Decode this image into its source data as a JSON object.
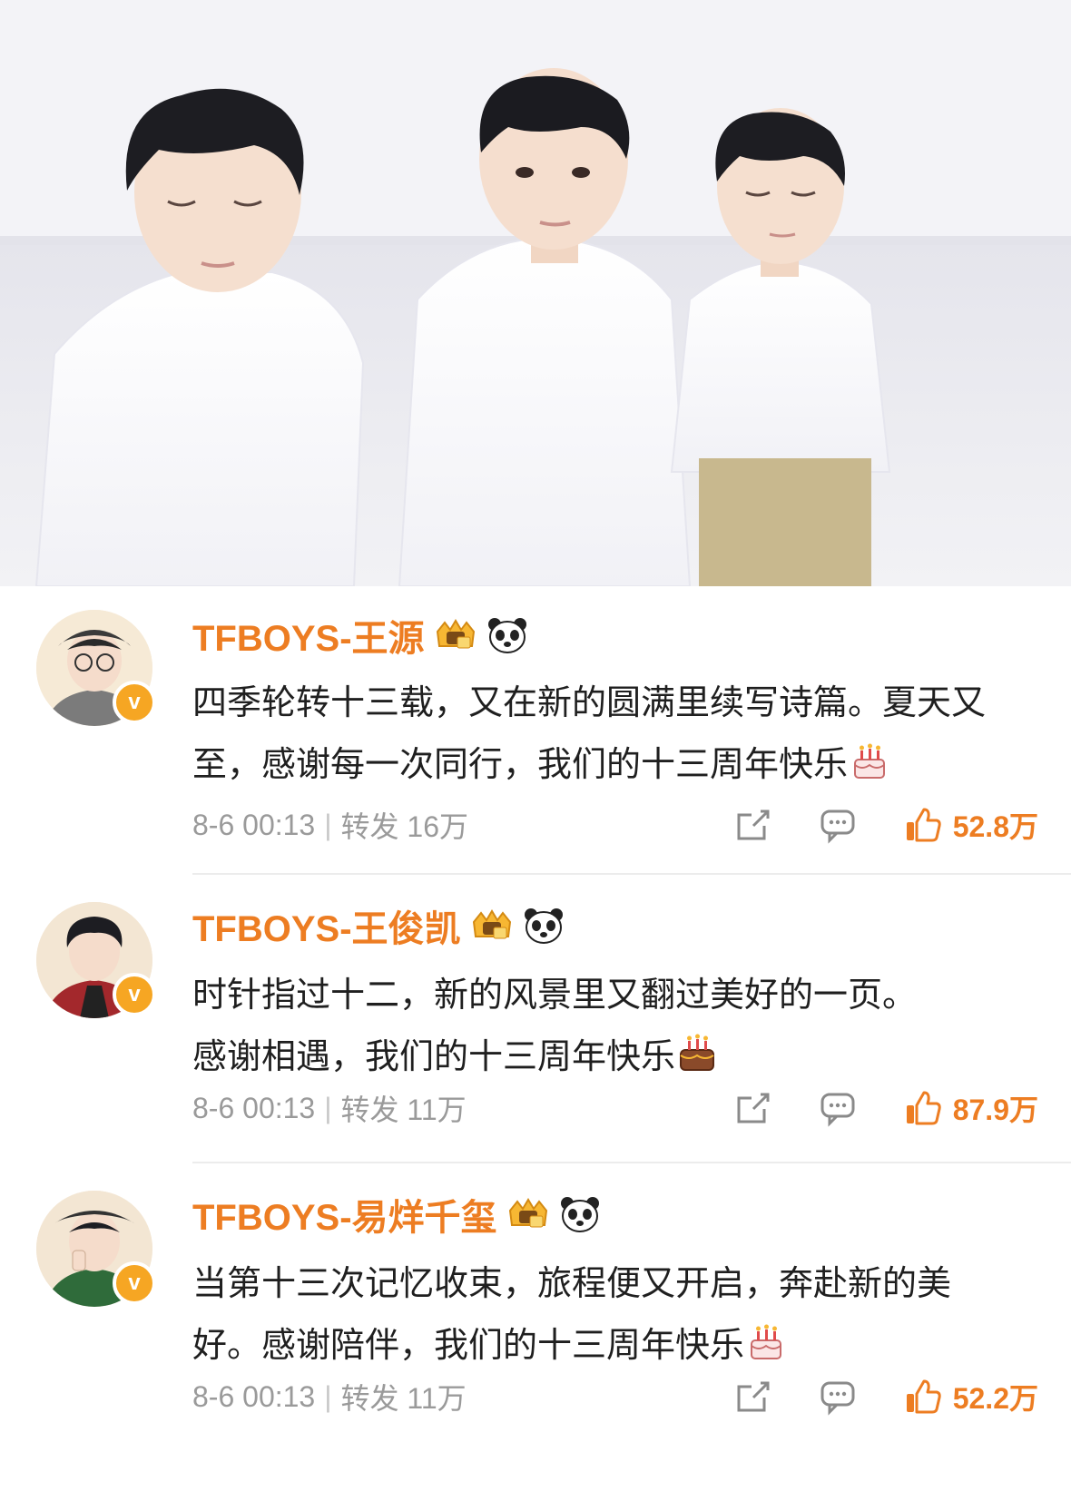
{
  "hero": {
    "image": "three-boys-white-shirts-photo"
  },
  "colors": {
    "name": "#ed7d22",
    "like": "#ed7d22",
    "meta": "#9a9a9a",
    "verified": "#f6a623"
  },
  "icons": {
    "verified": "v",
    "badge": "crown-badge-icon",
    "panda": "panda-icon",
    "cake": "birthday-cake-icon",
    "share": "share-icon",
    "comment": "comment-icon",
    "like": "thumbs-up-icon"
  },
  "posts": [
    {
      "name": "TFBOYS-王源",
      "text": "四季轮转十三载，又在新的圆满里续写诗篇。夏天又至，感谢每一次同行，我们的十三周年快乐",
      "time": "8-6 00:13",
      "sep": "|",
      "repost": "转发 16万",
      "likes": "52.8万"
    },
    {
      "name": "TFBOYS-王俊凯",
      "text": "时针指过十二，新的风景里又翻过美好的一页。感谢相遇，我们的十三周年快乐",
      "time": "8-6 00:13",
      "sep": "|",
      "repost": "转发 11万",
      "likes": "87.9万"
    },
    {
      "name": "TFBOYS-易烊千玺",
      "text": "当第十三次记忆收束，旅程便又开启，奔赴新的美好。感谢陪伴，我们的十三周年快乐",
      "time": "8-6 00:13",
      "sep": "|",
      "repost": "转发 11万",
      "likes": "52.2万"
    }
  ]
}
